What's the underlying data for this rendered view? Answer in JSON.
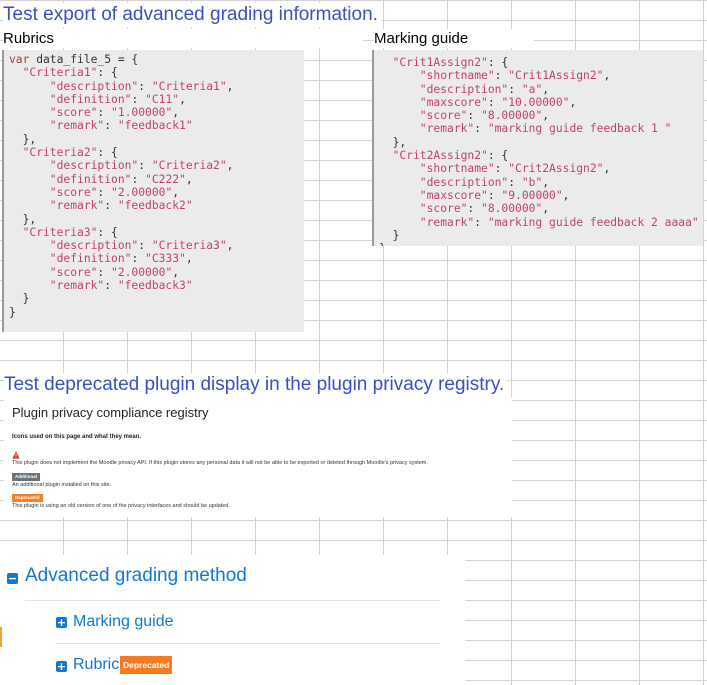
{
  "headings": {
    "export_title": "Test export of advanced grading information.",
    "rubrics": "Rubrics",
    "marking_guide": "Marking guide",
    "deprecated_title": "Test deprecated plugin display in the plugin privacy registry."
  },
  "rubrics_code": [
    [
      {
        "t": "k",
        "v": "var"
      },
      {
        "t": "p",
        "v": " data_file_5 = {"
      }
    ],
    [
      {
        "t": "s",
        "v": "  \"Criteria1\""
      },
      {
        "t": "p",
        "v": ": {"
      }
    ],
    [
      {
        "t": "s",
        "v": "      \"description\""
      },
      {
        "t": "p",
        "v": ": "
      },
      {
        "t": "s",
        "v": "\"Criteria1\""
      },
      {
        "t": "p",
        "v": ","
      }
    ],
    [
      {
        "t": "s",
        "v": "      \"definition\""
      },
      {
        "t": "p",
        "v": ": "
      },
      {
        "t": "s",
        "v": "\"C11\""
      },
      {
        "t": "p",
        "v": ","
      }
    ],
    [
      {
        "t": "s",
        "v": "      \"score\""
      },
      {
        "t": "p",
        "v": ": "
      },
      {
        "t": "s",
        "v": "\"1.00000\""
      },
      {
        "t": "p",
        "v": ","
      }
    ],
    [
      {
        "t": "s",
        "v": "      \"remark\""
      },
      {
        "t": "p",
        "v": ": "
      },
      {
        "t": "s",
        "v": "\"feedback1\""
      }
    ],
    [
      {
        "t": "p",
        "v": "  },"
      }
    ],
    [
      {
        "t": "s",
        "v": "  \"Criteria2\""
      },
      {
        "t": "p",
        "v": ": {"
      }
    ],
    [
      {
        "t": "s",
        "v": "      \"description\""
      },
      {
        "t": "p",
        "v": ": "
      },
      {
        "t": "s",
        "v": "\"Criteria2\""
      },
      {
        "t": "p",
        "v": ","
      }
    ],
    [
      {
        "t": "s",
        "v": "      \"definition\""
      },
      {
        "t": "p",
        "v": ": "
      },
      {
        "t": "s",
        "v": "\"C222\""
      },
      {
        "t": "p",
        "v": ","
      }
    ],
    [
      {
        "t": "s",
        "v": "      \"score\""
      },
      {
        "t": "p",
        "v": ": "
      },
      {
        "t": "s",
        "v": "\"2.00000\""
      },
      {
        "t": "p",
        "v": ","
      }
    ],
    [
      {
        "t": "s",
        "v": "      \"remark\""
      },
      {
        "t": "p",
        "v": ": "
      },
      {
        "t": "s",
        "v": "\"feedback2\""
      }
    ],
    [
      {
        "t": "p",
        "v": "  },"
      }
    ],
    [
      {
        "t": "s",
        "v": "  \"Criteria3\""
      },
      {
        "t": "p",
        "v": ": {"
      }
    ],
    [
      {
        "t": "s",
        "v": "      \"description\""
      },
      {
        "t": "p",
        "v": ": "
      },
      {
        "t": "s",
        "v": "\"Criteria3\""
      },
      {
        "t": "p",
        "v": ","
      }
    ],
    [
      {
        "t": "s",
        "v": "      \"definition\""
      },
      {
        "t": "p",
        "v": ": "
      },
      {
        "t": "s",
        "v": "\"C333\""
      },
      {
        "t": "p",
        "v": ","
      }
    ],
    [
      {
        "t": "s",
        "v": "      \"score\""
      },
      {
        "t": "p",
        "v": ": "
      },
      {
        "t": "s",
        "v": "\"2.00000\""
      },
      {
        "t": "p",
        "v": ","
      }
    ],
    [
      {
        "t": "s",
        "v": "      \"remark\""
      },
      {
        "t": "p",
        "v": ": "
      },
      {
        "t": "s",
        "v": "\"feedback3\""
      }
    ],
    [
      {
        "t": "p",
        "v": "  }"
      }
    ],
    [
      {
        "t": "p",
        "v": "}"
      }
    ]
  ],
  "marking_code": [
    [
      {
        "t": "s",
        "v": "  \"Crit1Assign2\""
      },
      {
        "t": "p",
        "v": ": {"
      }
    ],
    [
      {
        "t": "s",
        "v": "      \"shortname\""
      },
      {
        "t": "p",
        "v": ": "
      },
      {
        "t": "s",
        "v": "\"Crit1Assign2\""
      },
      {
        "t": "p",
        "v": ","
      }
    ],
    [
      {
        "t": "s",
        "v": "      \"description\""
      },
      {
        "t": "p",
        "v": ": "
      },
      {
        "t": "s",
        "v": "\"a\""
      },
      {
        "t": "p",
        "v": ","
      }
    ],
    [
      {
        "t": "s",
        "v": "      \"maxscore\""
      },
      {
        "t": "p",
        "v": ": "
      },
      {
        "t": "s",
        "v": "\"10.00000\""
      },
      {
        "t": "p",
        "v": ","
      }
    ],
    [
      {
        "t": "s",
        "v": "      \"score\""
      },
      {
        "t": "p",
        "v": ": "
      },
      {
        "t": "s",
        "v": "\"8.00000\""
      },
      {
        "t": "p",
        "v": ","
      }
    ],
    [
      {
        "t": "s",
        "v": "      \"remark\""
      },
      {
        "t": "p",
        "v": ": "
      },
      {
        "t": "s",
        "v": "\"marking guide feedback 1 \""
      }
    ],
    [
      {
        "t": "p",
        "v": "  },"
      }
    ],
    [
      {
        "t": "s",
        "v": "  \"Crit2Assign2\""
      },
      {
        "t": "p",
        "v": ": {"
      }
    ],
    [
      {
        "t": "s",
        "v": "      \"shortname\""
      },
      {
        "t": "p",
        "v": ": "
      },
      {
        "t": "s",
        "v": "\"Crit2Assign2\""
      },
      {
        "t": "p",
        "v": ","
      }
    ],
    [
      {
        "t": "s",
        "v": "      \"description\""
      },
      {
        "t": "p",
        "v": ": "
      },
      {
        "t": "s",
        "v": "\"b\""
      },
      {
        "t": "p",
        "v": ","
      }
    ],
    [
      {
        "t": "s",
        "v": "      \"maxscore\""
      },
      {
        "t": "p",
        "v": ": "
      },
      {
        "t": "s",
        "v": "\"9.00000\""
      },
      {
        "t": "p",
        "v": ","
      }
    ],
    [
      {
        "t": "s",
        "v": "      \"score\""
      },
      {
        "t": "p",
        "v": ": "
      },
      {
        "t": "s",
        "v": "\"8.00000\""
      },
      {
        "t": "p",
        "v": ","
      }
    ],
    [
      {
        "t": "s",
        "v": "      \"remark\""
      },
      {
        "t": "p",
        "v": ": "
      },
      {
        "t": "s",
        "v": "\"marking guide feedback 2 aaaa\""
      }
    ],
    [
      {
        "t": "p",
        "v": "  }"
      }
    ],
    [
      {
        "t": "p",
        "v": "}"
      }
    ]
  ],
  "registry": {
    "title": "Plugin privacy compliance registry",
    "icons_heading": "Icons used on this page and what they mean.",
    "warning_icon": "warning-triangle-icon",
    "warning_text": "This plugin does not implement the Moodle privacy API. If this plugin stores any personal data it will not be able to be exported or deleted through Moodle's privacy system.",
    "additional_badge": "Additional",
    "additional_text": "An additional plugin installed on this site.",
    "deprecated_badge": "Deprecated",
    "deprecated_text": "This plugin is using an old version of one of the privacy interfaces and should be updated."
  },
  "grading": {
    "title": "Advanced grading method",
    "collapse_icon": "minus-square-icon",
    "expand_icon": "plus-square-icon",
    "items": [
      {
        "label": "Marking guide"
      },
      {
        "label": "Rubric",
        "badge": "Deprecated"
      }
    ]
  },
  "colors": {
    "heading_blue": "#3a4fc2",
    "link_blue": "#1177d1",
    "badge_orange": "#f47b22",
    "badge_gray": "#6a737b",
    "code_bg": "#ebebeb",
    "code_string": "#c0436b",
    "code_keyword": "#a43e3e"
  }
}
